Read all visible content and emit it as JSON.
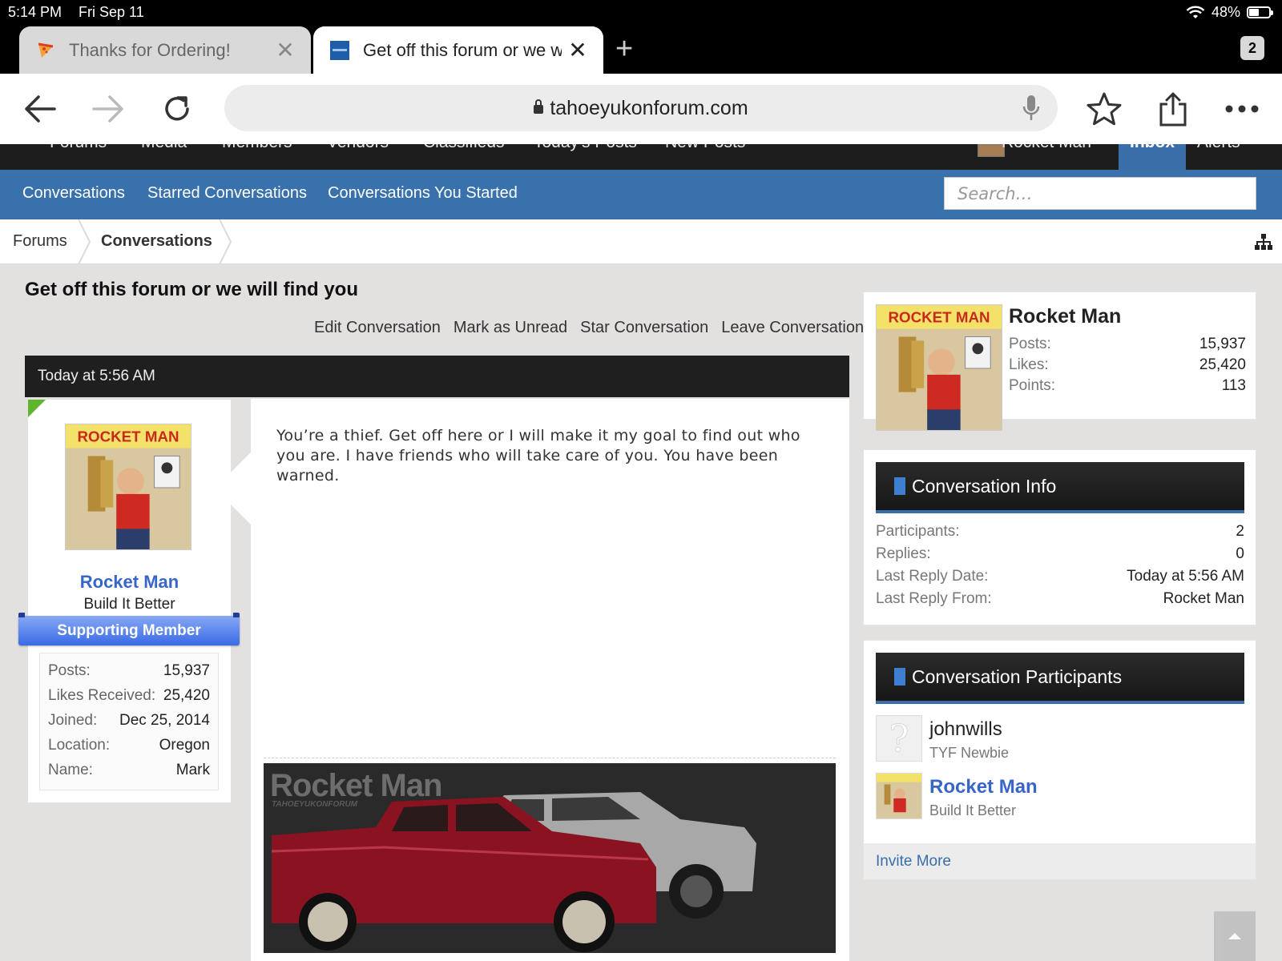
{
  "status_bar": {
    "time": "5:14 PM",
    "date": "Fri Sep 11",
    "battery": "48%",
    "battery_level": 0.48
  },
  "tabs": [
    {
      "label": "Thanks for Ordering!",
      "active": false,
      "favicon": "pizza-icon"
    },
    {
      "label": "Get off this forum or we will find you",
      "active": true,
      "favicon": "site-favicon"
    }
  ],
  "tab_count": "2",
  "toolbar": {
    "url": "tahoeyukonforum.com"
  },
  "site_nav": {
    "items": [
      "Forums",
      "Media",
      "Members",
      "Vendors",
      "Classifieds",
      "Today's Posts",
      "New Posts"
    ],
    "user": "Rocket Man",
    "inbox": "Inbox",
    "alerts": "Alerts"
  },
  "sub_nav": {
    "links": [
      "Conversations",
      "Starred Conversations",
      "Conversations You Started"
    ],
    "search_placeholder": "Search…"
  },
  "breadcrumb": [
    "Forums",
    "Conversations"
  ],
  "page_title": "Get off this forum or we will find you",
  "conversation_actions": [
    "Edit Conversation",
    "Mark as Unread",
    "Star Conversation",
    "Leave Conversation"
  ],
  "message": {
    "timestamp": "Today at 5:56 AM",
    "body": "You’re a thief. Get off here or I will make it my goal to find out who you are. I have friends who will take care of you. You have been warned.",
    "author": {
      "name": "Rocket Man",
      "title": "Build It Better",
      "badge": "Supporting Member",
      "avatar_text": "ROCKET MAN",
      "stats": [
        {
          "label": "Posts:",
          "value": "15,937"
        },
        {
          "label": "Likes Received:",
          "value": "25,420"
        },
        {
          "label": "Joined:",
          "value": "Dec 25, 2014"
        },
        {
          "label": "Location:",
          "value": "Oregon"
        },
        {
          "label": "Name:",
          "value": "Mark"
        }
      ]
    },
    "signature": {
      "title": "Rocket Man",
      "subtitle": "TAHOEYUKONFORUM"
    }
  },
  "sidebar": {
    "user_card": {
      "name": "Rocket Man",
      "avatar_text": "ROCKET MAN",
      "stats": [
        {
          "label": "Posts:",
          "value": "15,937"
        },
        {
          "label": "Likes:",
          "value": "25,420"
        },
        {
          "label": "Points:",
          "value": "113"
        }
      ]
    },
    "conversation_info": {
      "title": "Conversation Info",
      "rows": [
        {
          "label": "Participants:",
          "value": "2"
        },
        {
          "label": "Replies:",
          "value": "0"
        },
        {
          "label": "Last Reply Date:",
          "value": "Today at 5:56 AM"
        },
        {
          "label": "Last Reply From:",
          "value": "Rocket Man"
        }
      ]
    },
    "participants": {
      "title": "Conversation Participants",
      "list": [
        {
          "name": "johnwills",
          "title": "TYF Newbie"
        },
        {
          "name": "Rocket Man",
          "title": "Build It Better"
        }
      ],
      "invite": "Invite More"
    }
  },
  "colors": {
    "nav_blue": "#3971ac",
    "link_blue": "#3866c7",
    "header_dark": "#1f1f1f",
    "flag_green": "#5fb52b"
  }
}
